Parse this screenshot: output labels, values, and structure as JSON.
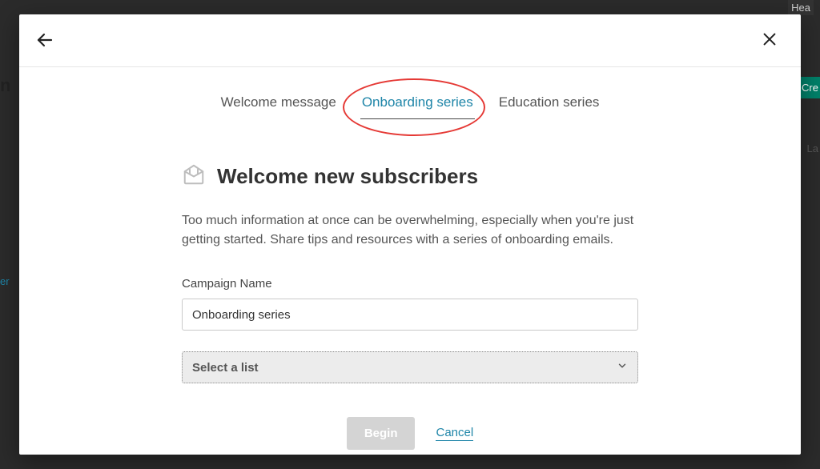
{
  "background": {
    "hea_fragment": "Hea",
    "n_fragment": "n",
    "cr_fragment": "Cre",
    "la_fragment": "La",
    "er_fragment": "er"
  },
  "tabs": {
    "welcome": "Welcome message",
    "onboarding": "Onboarding series",
    "education": "Education series"
  },
  "content": {
    "heading": "Welcome new subscribers",
    "description": "Too much information at once can be overwhelming, especially when you're just getting started. Share tips and resources with a series of onboarding emails.",
    "campaign_label": "Campaign Name",
    "campaign_value": "Onboarding series",
    "select_placeholder": "Select a list"
  },
  "actions": {
    "begin": "Begin",
    "cancel": "Cancel"
  },
  "colors": {
    "accent": "#1e85a8",
    "highlight": "#e53935"
  }
}
